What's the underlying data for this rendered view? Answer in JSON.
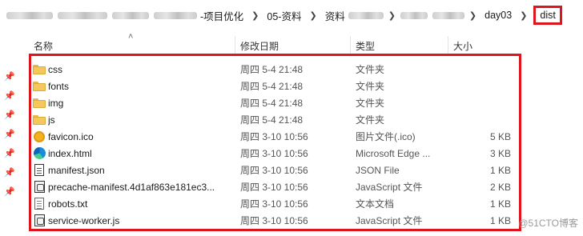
{
  "breadcrumb": {
    "items": [
      "-项目优化",
      "05-资料",
      "资料",
      "day03",
      "dist"
    ]
  },
  "header": {
    "name": "名称",
    "date": "修改日期",
    "type": "类型",
    "size": "大小"
  },
  "files": [
    {
      "icon": "folder-icon",
      "name": "css",
      "date": "周四 5-4 21:48",
      "type": "文件夹",
      "size": ""
    },
    {
      "icon": "folder-icon",
      "name": "fonts",
      "date": "周四 5-4 21:48",
      "type": "文件夹",
      "size": ""
    },
    {
      "icon": "folder-icon",
      "name": "img",
      "date": "周四 5-4 21:48",
      "type": "文件夹",
      "size": ""
    },
    {
      "icon": "folder-icon",
      "name": "js",
      "date": "周四 5-4 21:48",
      "type": "文件夹",
      "size": ""
    },
    {
      "icon": "favicon-icon",
      "name": "favicon.ico",
      "date": "周四 3-10 10:56",
      "type": "图片文件(.ico)",
      "size": "5 KB"
    },
    {
      "icon": "edge-icon",
      "name": "index.html",
      "date": "周四 3-10 10:56",
      "type": "Microsoft Edge ...",
      "size": "3 KB"
    },
    {
      "icon": "json-file-icon",
      "name": "manifest.json",
      "date": "周四 3-10 10:56",
      "type": "JSON File",
      "size": "1 KB"
    },
    {
      "icon": "js-file-icon",
      "name": "precache-manifest.4d1af863e181ec3...",
      "date": "周四 3-10 10:56",
      "type": "JavaScript 文件",
      "size": "2 KB"
    },
    {
      "icon": "text-file-icon",
      "name": "robots.txt",
      "date": "周四 3-10 10:56",
      "type": "文本文档",
      "size": "1 KB"
    },
    {
      "icon": "js-file-icon",
      "name": "service-worker.js",
      "date": "周四 3-10 10:56",
      "type": "JavaScript 文件",
      "size": "1 KB"
    }
  ],
  "watermark": "@51CTO博客",
  "colors": {
    "highlight": "#e0141c",
    "folder": "#f5c85c"
  }
}
